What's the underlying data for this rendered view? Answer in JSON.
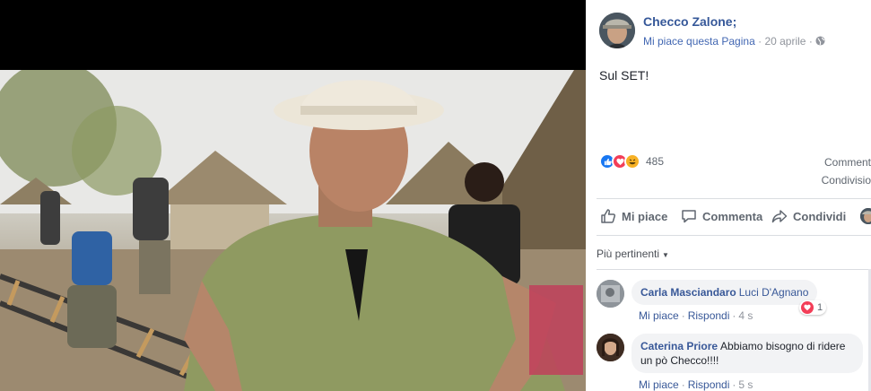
{
  "post": {
    "author": "Checco Zalone;",
    "like_page": "Mi piace questa Pagina",
    "separator": "·",
    "date": "20 aprile",
    "privacy_icon": "globe-icon",
    "text": "Sul SET!"
  },
  "reactions": {
    "icons": [
      "like-reaction-icon",
      "love-reaction-icon",
      "haha-reaction-icon"
    ],
    "count": "485",
    "comments_label": "Comment",
    "shares_label": "Condivisio"
  },
  "actions": {
    "like": "Mi piace",
    "comment": "Commenta",
    "share": "Condividi"
  },
  "comments_sort": "Più pertinenti",
  "comments": [
    {
      "author": "Carla Masciandaro",
      "tag": "Luci D'Agnano",
      "text": "",
      "like": "Mi piace",
      "reply": "Rispondi",
      "time": "4 s",
      "reaction_count": "1"
    },
    {
      "author": "Caterina Priore",
      "tag": "",
      "text": "Abbiamo bisogno di ridere un pò Checco!!!!",
      "like": "Mi piace",
      "reply": "Rispondi",
      "time": "5 s"
    }
  ],
  "colors": {
    "link": "#365899",
    "like_blue": "#1877f2",
    "love_red": "#f33e58",
    "haha_yellow": "#f7b125"
  }
}
